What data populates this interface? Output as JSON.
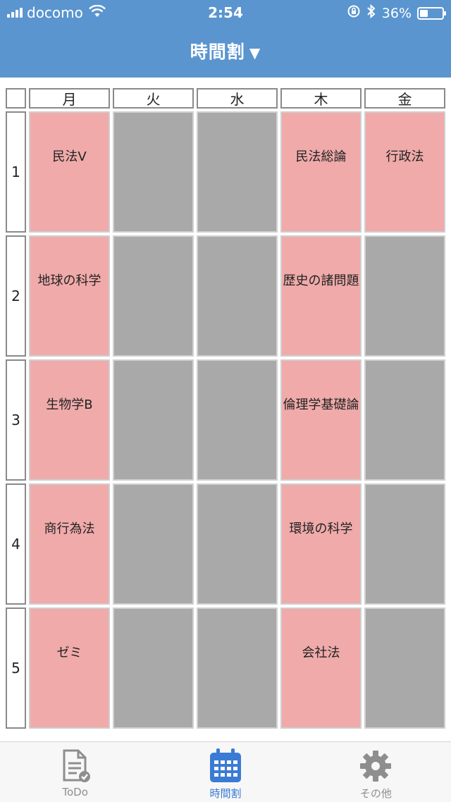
{
  "status_bar": {
    "carrier": "docomo",
    "time": "2:54",
    "battery_percent": "36%",
    "battery_level": 0.36
  },
  "nav": {
    "title": "時間割",
    "caret": "▼"
  },
  "timetable": {
    "days": [
      "月",
      "火",
      "水",
      "木",
      "金"
    ],
    "periods": [
      {
        "number": "1",
        "cells": [
          "民法V",
          "",
          "",
          "民法総論",
          "行政法"
        ]
      },
      {
        "number": "2",
        "cells": [
          "地球の科学",
          "",
          "",
          "歴史の諸問題",
          ""
        ]
      },
      {
        "number": "3",
        "cells": [
          "生物学B",
          "",
          "",
          "倫理学基礎論",
          ""
        ]
      },
      {
        "number": "4",
        "cells": [
          "商行為法",
          "",
          "",
          "環境の科学",
          ""
        ]
      },
      {
        "number": "5",
        "cells": [
          "ゼミ",
          "",
          "",
          "会社法",
          ""
        ]
      }
    ]
  },
  "colors": {
    "header": "#5a95cf",
    "filled_cell": "#f0aaaa",
    "empty_cell": "#a9a9a9",
    "active_tab": "#3a7bd5",
    "inactive_tab": "#8e8e8e"
  },
  "tabs": [
    {
      "label": "ToDo",
      "icon": "todo-document-icon",
      "active": false
    },
    {
      "label": "時間割",
      "icon": "calendar-icon",
      "active": true
    },
    {
      "label": "その他",
      "icon": "gear-icon",
      "active": false
    }
  ]
}
